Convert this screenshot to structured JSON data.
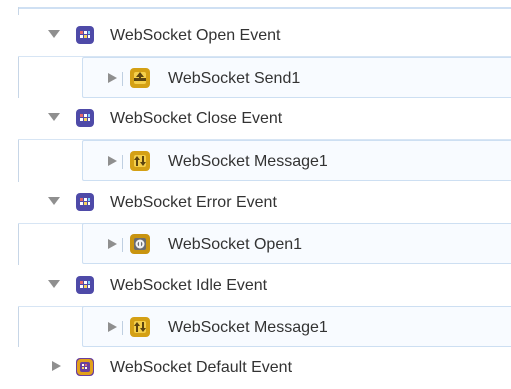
{
  "tree": {
    "rows": [
      {
        "type": "event",
        "label": "WebSocket Open Event",
        "toggle": "expanded",
        "icon": "websocket-event-icon",
        "accent": "#4e4aa8"
      },
      {
        "type": "action",
        "label": "WebSocket Send1",
        "toggle": "collapsed",
        "icon": "websocket-send-icon",
        "accent": "#d4a015"
      },
      {
        "type": "event",
        "label": "WebSocket Close Event",
        "toggle": "expanded",
        "icon": "websocket-event-icon",
        "accent": "#4e4aa8"
      },
      {
        "type": "action",
        "label": "WebSocket Message1",
        "toggle": "collapsed",
        "icon": "websocket-message-icon",
        "accent": "#d4a015"
      },
      {
        "type": "event",
        "label": "WebSocket Error Event",
        "toggle": "expanded",
        "icon": "websocket-event-icon",
        "accent": "#4e4aa8"
      },
      {
        "type": "action",
        "label": "WebSocket Open1",
        "toggle": "collapsed",
        "icon": "websocket-open-icon",
        "accent": "#c99410"
      },
      {
        "type": "event",
        "label": "WebSocket Idle Event",
        "toggle": "expanded",
        "icon": "websocket-event-icon",
        "accent": "#4e4aa8"
      },
      {
        "type": "action",
        "label": "WebSocket Message1",
        "toggle": "collapsed",
        "icon": "websocket-message-icon",
        "accent": "#d4a015"
      },
      {
        "type": "event",
        "label": "WebSocket Default Event",
        "toggle": "collapsed",
        "icon": "websocket-default-event-icon",
        "accent": "#6a3f9c"
      }
    ]
  },
  "colors": {
    "border_light": "#d7e5f4",
    "child_bg": "#f8fbff",
    "text": "#333333",
    "toggle": "#8f8f8f"
  }
}
